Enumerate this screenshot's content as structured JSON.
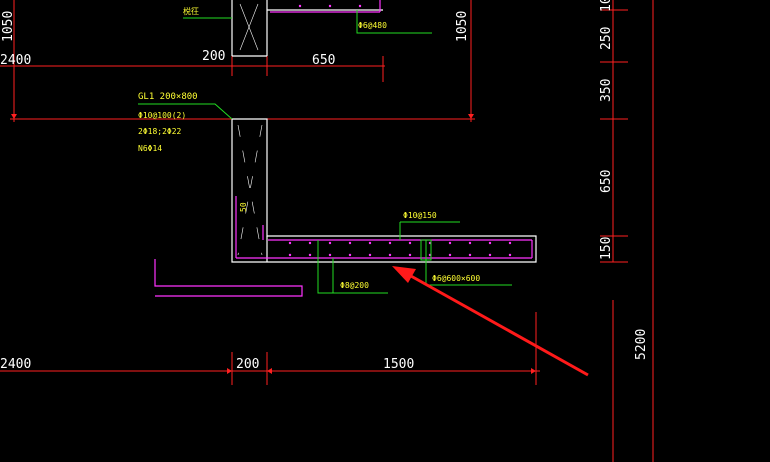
{
  "colors": {
    "background": "#000000",
    "dimension": "#ff2020",
    "wall": "#ffffff",
    "rebar": "#ff33ff",
    "leader": "#22dd22",
    "annotation": "#ffff33",
    "arrow": "#ff1a1a"
  },
  "top": {
    "dim_left": "2400",
    "dim_200": "200",
    "dim_650": "650",
    "vertical_1050_left": "1050",
    "vertical_1050_right": "1050",
    "top_label": "棁彺",
    "phi6_480": "Φ6@480"
  },
  "beam_note": {
    "line1": "GL1 200×800",
    "line2": "Φ10@100(2)",
    "line3": "2Φ18;2Φ22",
    "line4": "N6Φ14"
  },
  "slab": {
    "phi10_150": "Φ10@150",
    "phi8_200": "Φ8@200",
    "phi6_600x600": "Φ6@600×600",
    "small_label": "50"
  },
  "right_dims": {
    "d10": "10",
    "d250": "250",
    "d350": "350",
    "d650": "650",
    "d150": "150",
    "d5200": "5200"
  },
  "bottom": {
    "dim_left": "2400",
    "dim_200": "200",
    "dim_1500": "1500"
  }
}
